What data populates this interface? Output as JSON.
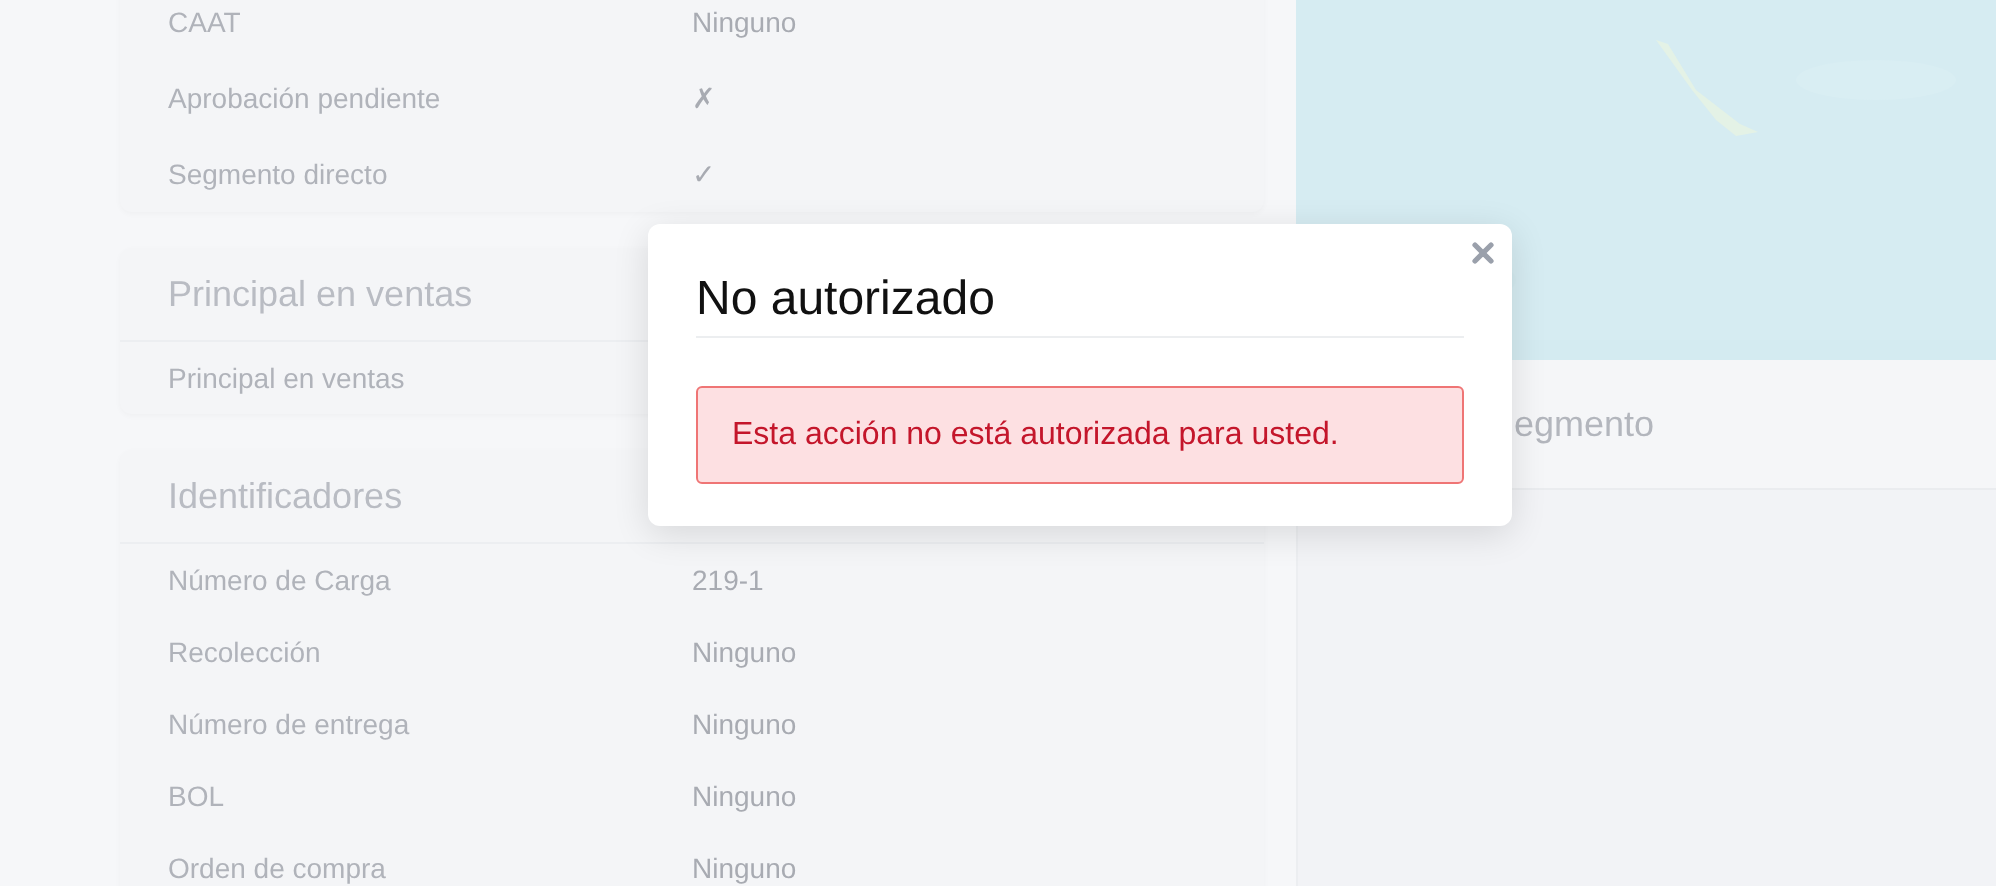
{
  "sections": [
    {
      "rows": [
        {
          "label": "CAAT",
          "value": "Ninguno"
        },
        {
          "label": "Aprobación pendiente",
          "value": "✗"
        },
        {
          "label": "Segmento directo",
          "value": "✓"
        }
      ]
    },
    {
      "title": "Principal en ventas",
      "rows": [
        {
          "label": "Principal en ventas"
        }
      ]
    },
    {
      "title": "Identificadores",
      "rows": [
        {
          "label": "Número de Carga",
          "value": "219-1"
        },
        {
          "label": "Recolección",
          "value": "Ninguno"
        },
        {
          "label": "Número de entrega",
          "value": "Ninguno"
        },
        {
          "label": "BOL",
          "value": "Ninguno"
        },
        {
          "label": "Orden de compra",
          "value": "Ninguno"
        }
      ]
    }
  ],
  "segment_panel": {
    "title": "egmento"
  },
  "modal": {
    "title": "No autorizado",
    "alert": {
      "kind": "error",
      "message": "Esta acción no está autorizada para usted."
    }
  }
}
